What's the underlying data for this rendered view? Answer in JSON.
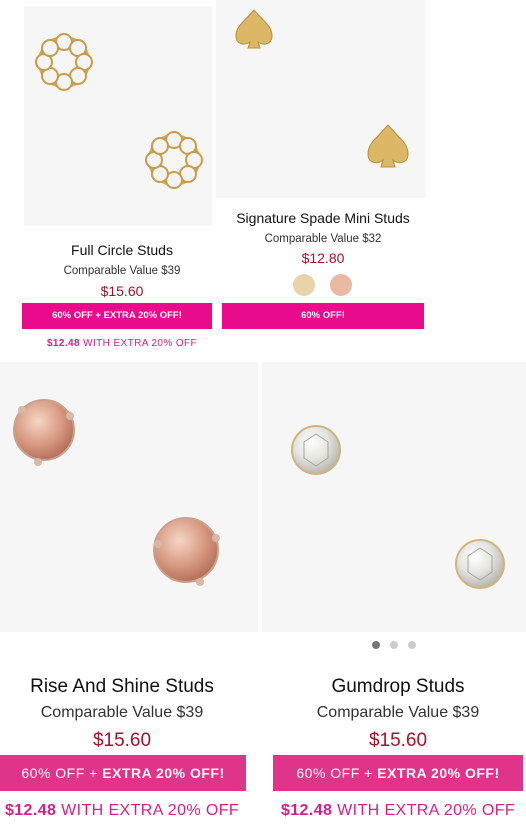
{
  "products": [
    {
      "name": "Full Circle Studs",
      "comparable": "Comparable Value $39",
      "price": "$15.60",
      "promo": "60% OFF + EXTRA 20% OFF!",
      "extra_price": "$12.48",
      "extra_text": "WITH EXTRA 20% OFF"
    },
    {
      "name": "Signature Spade Mini Studs",
      "comparable": "Comparable Value $32",
      "price": "$12.80",
      "promo": "60% OFF!",
      "swatches": [
        {
          "name": "gold-swatch",
          "color": "#e8d4a8"
        },
        {
          "name": "rose-gold-swatch",
          "color": "#e9b9a3"
        }
      ]
    },
    {
      "name": "Rise And Shine Studs",
      "comparable": "Comparable Value $39",
      "price": "$15.60",
      "promo_a": "60% OFF + ",
      "promo_b": "EXTRA 20% OFF!",
      "extra_price": "$12.48",
      "extra_text": "WITH EXTRA 20% OFF"
    },
    {
      "name": "Gumdrop Studs",
      "comparable": "Comparable Value $39",
      "price": "$15.60",
      "promo_a": "60% OFF + ",
      "promo_b": "EXTRA 20% OFF!",
      "extra_price": "$12.48",
      "extra_text": "WITH EXTRA 20% OFF",
      "carousel_dots": 3,
      "carousel_active": 1
    }
  ],
  "colors": {
    "promo_pink": "#ea0a8c",
    "promo_pink_light": "#e0338a",
    "price_red": "#a3132a",
    "extra_pink": "#d61f8a"
  }
}
